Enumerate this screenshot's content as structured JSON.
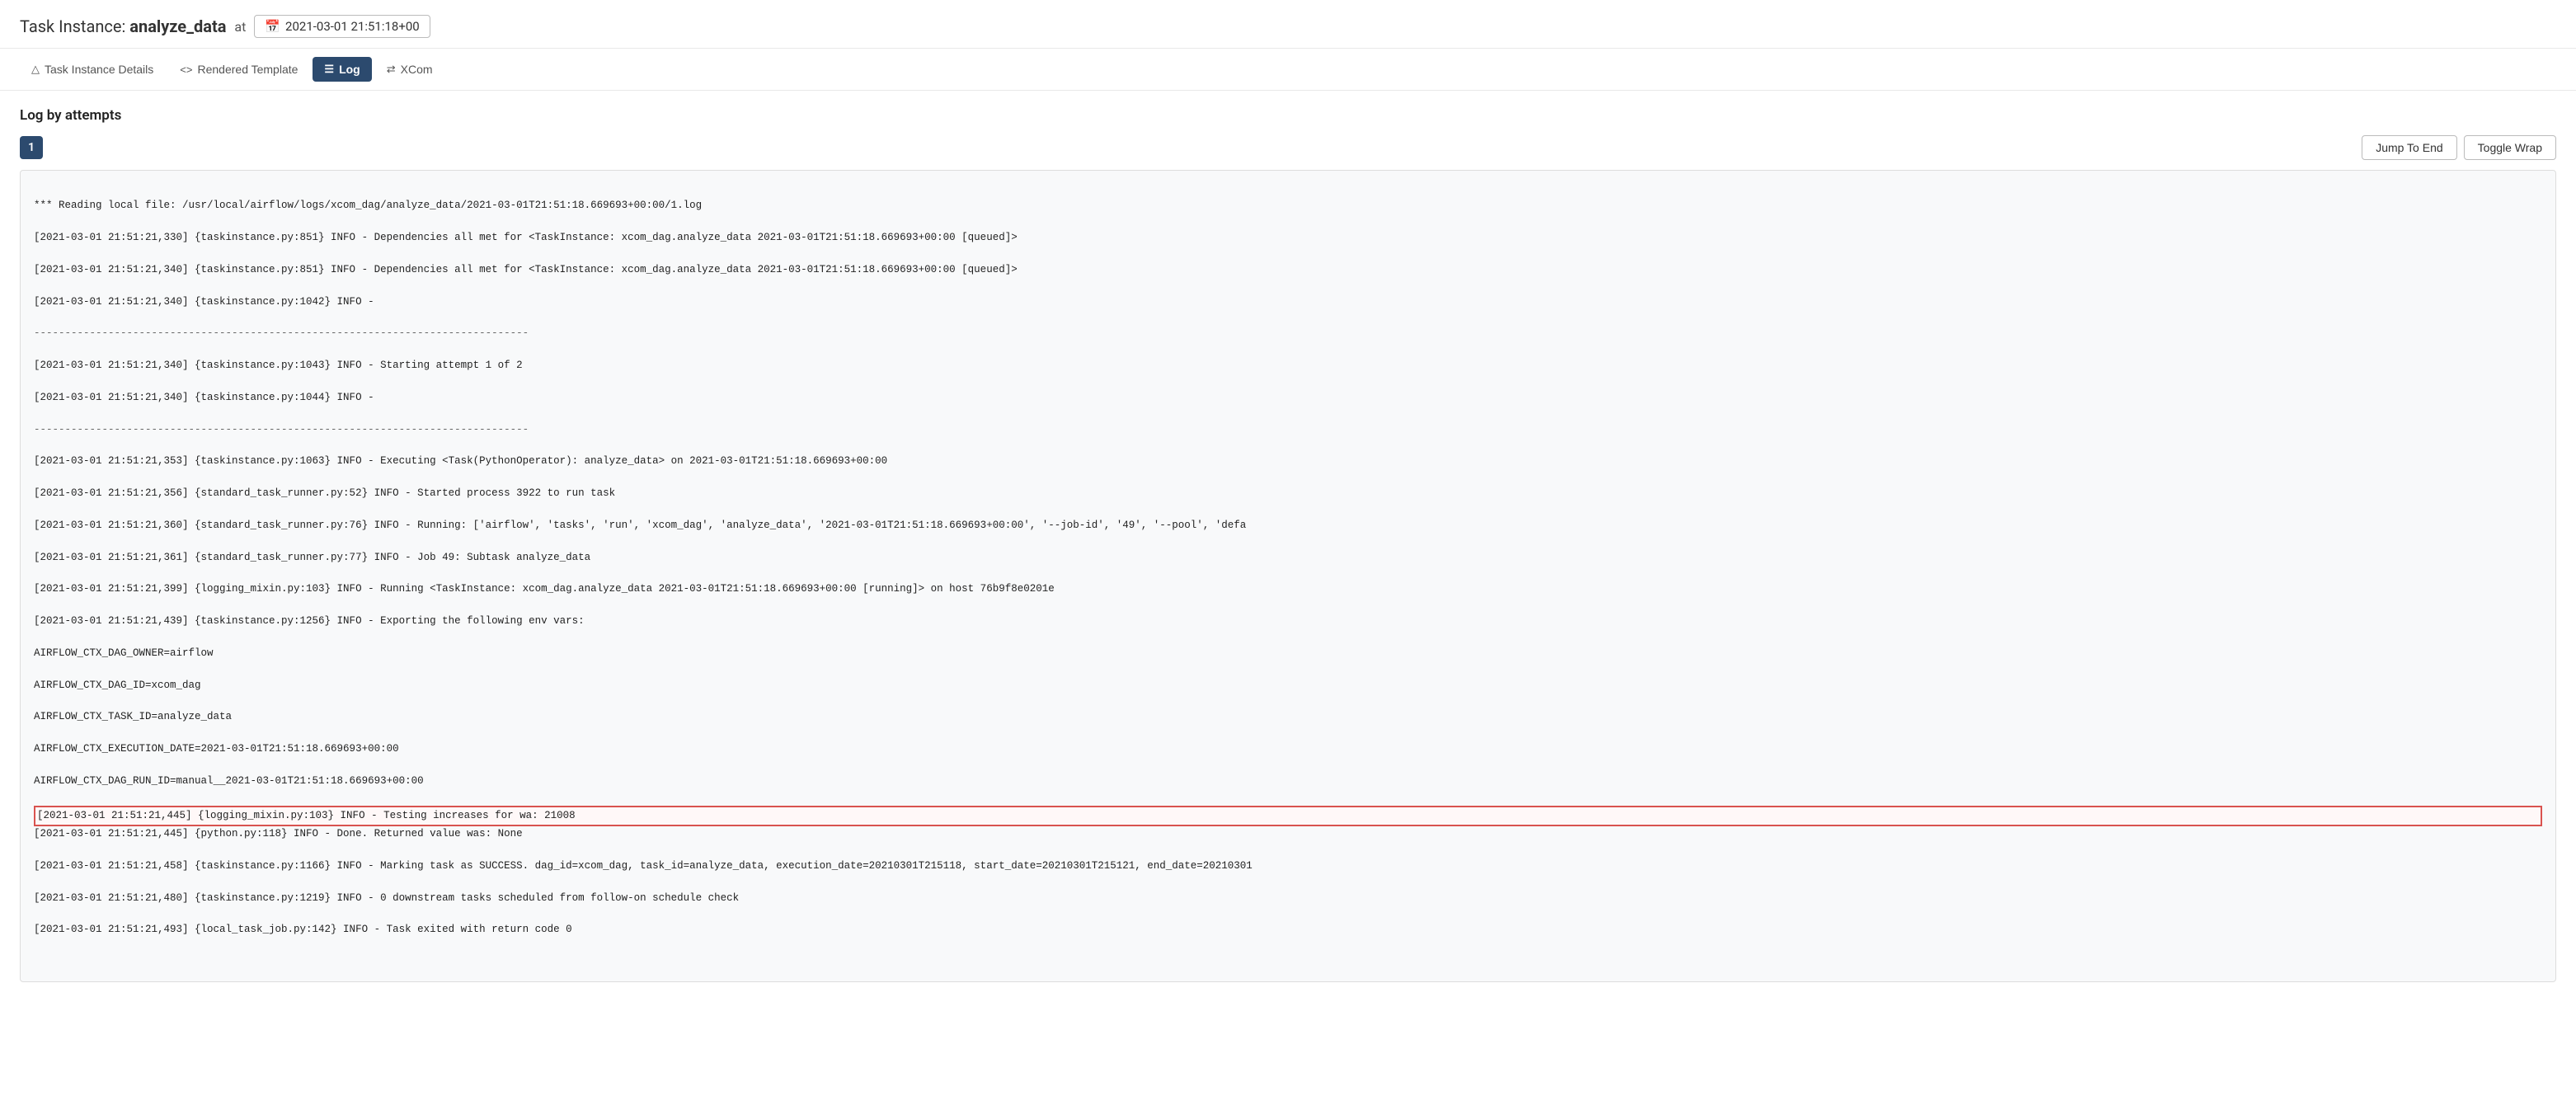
{
  "header": {
    "prefix": "Task Instance:",
    "task_name": "analyze_data",
    "at_label": "at",
    "datetime": "2021-03-01 21:51:18+00",
    "calendar_icon": "📅"
  },
  "tabs": [
    {
      "id": "task-instance-details",
      "label": "Task Instance Details",
      "icon": "⚠",
      "active": false
    },
    {
      "id": "rendered-template",
      "label": "Rendered Template",
      "icon": "<>",
      "active": false
    },
    {
      "id": "log",
      "label": "Log",
      "icon": "≡",
      "active": true
    },
    {
      "id": "xcom",
      "label": "XCom",
      "icon": "⇄",
      "active": false
    }
  ],
  "log_section": {
    "title": "Log by attempts",
    "attempt_number": "1",
    "jump_to_end_label": "Jump To End",
    "toggle_wrap_label": "Toggle Wrap",
    "log_lines": [
      "*** Reading local file: /usr/local/airflow/logs/xcom_dag/analyze_data/2021-03-01T21:51:18.669693+00:00/1.log",
      "[2021-03-01 21:51:21,330] {taskinstance.py:851} INFO - Dependencies all met for <TaskInstance: xcom_dag.analyze_data 2021-03-01T21:51:18.669693+00:00 [queued]>",
      "[2021-03-01 21:51:21,340] {taskinstance.py:851} INFO - Dependencies all met for <TaskInstance: xcom_dag.analyze_data 2021-03-01T21:51:18.669693+00:00 [queued]>",
      "[2021-03-01 21:51:21,340] {taskinstance.py:1042} INFO -",
      "--------------------------------------------------------------------------------",
      "[2021-03-01 21:51:21,340] {taskinstance.py:1043} INFO - Starting attempt 1 of 2",
      "[2021-03-01 21:51:21,340] {taskinstance.py:1044} INFO -",
      "--------------------------------------------------------------------------------",
      "[2021-03-01 21:51:21,353] {taskinstance.py:1063} INFO - Executing <Task(PythonOperator): analyze_data> on 2021-03-01T21:51:18.669693+00:00",
      "[2021-03-01 21:51:21,356] {standard_task_runner.py:52} INFO - Started process 3922 to run task",
      "[2021-03-01 21:51:21,360] {standard_task_runner.py:76} INFO - Running: ['airflow', 'tasks', 'run', 'xcom_dag', 'analyze_data', '2021-03-01T21:51:18.669693+00:00', '--job-id', '49', '--pool', 'defa",
      "[2021-03-01 21:51:21,361] {standard_task_runner.py:77} INFO - Job 49: Subtask analyze_data",
      "[2021-03-01 21:51:21,399] {logging_mixin.py:103} INFO - Running <TaskInstance: xcom_dag.analyze_data 2021-03-01T21:51:18.669693+00:00 [running]> on host 76b9f8e0201e",
      "[2021-03-01 21:51:21,439] {taskinstance.py:1256} INFO - Exporting the following env vars:",
      "AIRFLOW_CTX_DAG_OWNER=airflow",
      "AIRFLOW_CTX_DAG_ID=xcom_dag",
      "AIRFLOW_CTX_TASK_ID=analyze_data",
      "AIRFLOW_CTX_EXECUTION_DATE=2021-03-01T21:51:18.669693+00:00",
      "AIRFLOW_CTX_DAG_RUN_ID=manual__2021-03-01T21:51:18.669693+00:00"
    ],
    "highlighted_line": "[2021-03-01 21:51:21,445] {logging_mixin.py:103} INFO - Testing increases for wa: 21008",
    "log_lines_after": [
      "[2021-03-01 21:51:21,445] {python.py:118} INFO - Done. Returned value was: None",
      "[2021-03-01 21:51:21,458] {taskinstance.py:1166} INFO - Marking task as SUCCESS. dag_id=xcom_dag, task_id=analyze_data, execution_date=20210301T215118, start_date=20210301T215121, end_date=20210301",
      "[2021-03-01 21:51:21,480] {taskinstance.py:1219} INFO - 0 downstream tasks scheduled from follow-on schedule check",
      "[2021-03-01 21:51:21,493] {local_task_job.py:142} INFO - Task exited with return code 0"
    ]
  }
}
